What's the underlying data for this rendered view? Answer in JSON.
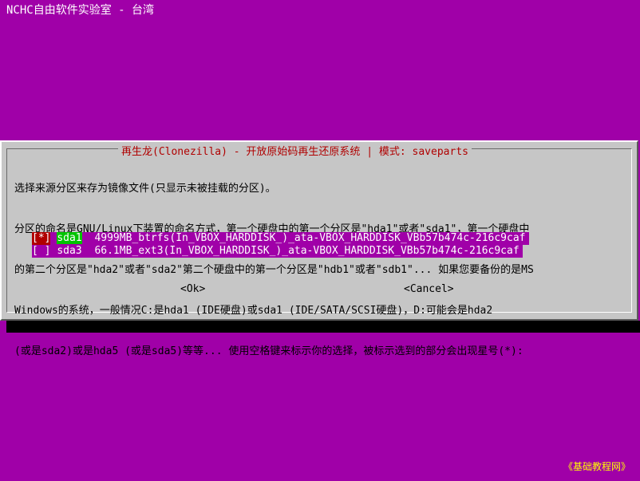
{
  "backtitle": "NCHC自由软件实验室 - 台湾",
  "dialog": {
    "title": "再生龙(Clonezilla) - 开放原始码再生还原系统 | 模式: saveparts",
    "message_lines": [
      "选择来源分区来存为镜像文件(只显示未被挂载的分区)。",
      "分区的命名是GNU/Linux下装置的命名方式，第一个硬盘中的第一个分区是\"hda1\"或者\"sda1\"，第一个硬盘中",
      "的第二个分区是\"hda2\"或者\"sda2\"第二个硬盘中的第一个分区是\"hdb1\"或者\"sdb1\"... 如果您要备份的是MS",
      "Windows的系统，一般情况C:是hda1 (IDE硬盘)或sda1 (IDE/SATA/SCSI硬盘)，D:可能会是hda2",
      "(或是sda2)或是hda5 (或是sda5)等等... 使用空格键来标示你的选择，被标示选到的部分会出现星号(*):"
    ],
    "items": [
      {
        "checkbox": "[*]",
        "tag": "sda1",
        "desc": "4999MB_btrfs(In_VBOX_HARDDISK_)_ata-VBOX_HARDDISK_VBb57b474c-216c9caf"
      },
      {
        "checkbox": "[ ]",
        "tag": "sda3",
        "desc": "66.1MB_ext3(In_VBOX_HARDDISK_)_ata-VBOX_HARDDISK_VBb57b474c-216c9caf"
      }
    ],
    "ok_label": "<Ok>",
    "cancel_label": "<Cancel>"
  },
  "watermark": "《基础教程网》",
  "colors": {
    "background": "#a000a8",
    "dialog_bg": "#c6c6c6",
    "title_text": "#b00000",
    "highlight_tag": "#00c400"
  }
}
